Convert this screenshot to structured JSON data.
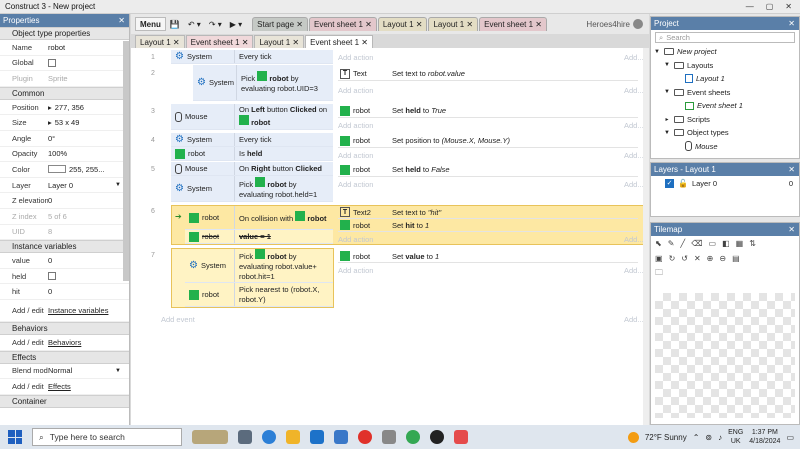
{
  "window": {
    "title": "Construct 3 - New project"
  },
  "left_panel": {
    "title": "Properties",
    "close": "✕",
    "sections": {
      "object_type": "Object type properties",
      "common": "Common",
      "instance_vars": "Instance variables",
      "behaviors": "Behaviors",
      "effects": "Effects",
      "container": "Container"
    },
    "name": {
      "k": "Name",
      "v": "robot"
    },
    "global": {
      "k": "Global"
    },
    "plugin": {
      "k": "Plugin",
      "v": "Sprite"
    },
    "position": {
      "k": "Position",
      "v": "277, 356"
    },
    "size": {
      "k": "Size",
      "v": "53 x 49"
    },
    "angle": {
      "k": "Angle",
      "v": "0°"
    },
    "opacity": {
      "k": "Opacity",
      "v": "100%"
    },
    "color": {
      "k": "Color",
      "v": "255, 255..."
    },
    "layer": {
      "k": "Layer",
      "v": "Layer 0"
    },
    "zelev": {
      "k": "Z elevation",
      "v": "0"
    },
    "zindex": {
      "k": "Z index",
      "v": "5 of 6"
    },
    "uid": {
      "k": "UID",
      "v": "8"
    },
    "var_value": {
      "k": "value",
      "v": "0"
    },
    "var_held": {
      "k": "held"
    },
    "var_hit": {
      "k": "hit",
      "v": "0"
    },
    "addedit_vars": {
      "k": "Add / edit",
      "v": "Instance variables"
    },
    "addedit_beh": {
      "k": "Add / edit",
      "v": "Behaviors"
    },
    "blend": {
      "k": "Blend mode",
      "v": "Normal"
    },
    "addedit_fx": {
      "k": "Add / edit",
      "v": "Effects"
    }
  },
  "toolbar": {
    "menu": "Menu",
    "save": "💾",
    "undo": "↶ ▾",
    "redo": "↷ ▾",
    "play": "▶ ▾",
    "user": "Heroes4hire",
    "tabs": [
      "Start page ✕",
      "Event sheet 1 ✕",
      "Layout 1 ✕",
      "Layout 1 ✕",
      "Event sheet 1 ✕"
    ]
  },
  "subtabs": [
    "Layout 1 ✕",
    "Event sheet 1 ✕",
    "Layout 1 ✕",
    "Event sheet 1 ✕"
  ],
  "sheet": {
    "add_action": "Add action",
    "add_dots": "Add...",
    "add_event": "Add event",
    "nums": [
      "1",
      "2",
      "3",
      "4",
      "5",
      "6",
      "7"
    ],
    "e1": {
      "obj": "System",
      "cond": "Every tick"
    },
    "e2": {
      "obj": "System",
      "cond_a": "Pick",
      "cond_obj": "robot",
      "cond_b": "by evaluating robot.UID=3",
      "a_obj": "Text",
      "a_pre": "Set text to",
      "a_val": "robot.value"
    },
    "e3": {
      "obj": "Mouse",
      "cond_a": "On",
      "btn": "Left",
      "cond_b": "button",
      "clk": "Clicked",
      "cond_c": "on",
      "cond_obj": "robot",
      "a_obj": "robot",
      "a_pre": "Set",
      "a_var": "held",
      "a_mid": "to",
      "a_val": "True"
    },
    "e4": {
      "obj1": "System",
      "cond1": "Every tick",
      "obj2": "robot",
      "cond2_a": "Is",
      "cond2_b": "held",
      "a_obj": "robot",
      "a_pre": "Set position to",
      "a_val": "(Mouse.X, Mouse.Y)"
    },
    "e5": {
      "obj1": "Mouse",
      "cond1_a": "On",
      "btn": "Right",
      "cond1_b": "button",
      "clk": "Clicked",
      "obj2": "System",
      "cond2_a": "Pick",
      "cond2_obj": "robot",
      "cond2_b": "by evaluating robot.held=1",
      "a_obj": "robot",
      "a_pre": "Set",
      "a_var": "held",
      "a_mid": "to",
      "a_val": "False"
    },
    "e6": {
      "obj1": "robot",
      "cond1_a": "On collision with",
      "cond1_obj": "robot",
      "obj2": "robot",
      "cond2": "value = 1",
      "a1_obj": "Text2",
      "a1_pre": "Set text to",
      "a1_val": "\"hit\"",
      "a2_obj": "robot",
      "a2_pre": "Set",
      "a2_var": "hit",
      "a2_mid": "to",
      "a2_val": "1"
    },
    "e7": {
      "obj1": "System",
      "cond1_a": "Pick",
      "cond1_obj": "robot",
      "cond1_b": "by evaluating robot.value+ robot.hit=1",
      "obj2": "robot",
      "cond2": "Pick nearest to (robot.X, robot.Y)",
      "a_obj": "robot",
      "a_pre": "Set",
      "a_var": "value",
      "a_mid": "to",
      "a_val": "1"
    }
  },
  "project_panel": {
    "title": "Project",
    "search": "Search",
    "items": [
      "New project",
      "Layouts",
      "Layout 1",
      "Event sheets",
      "Event sheet 1",
      "Scripts",
      "Object types",
      "Mouse"
    ]
  },
  "layers_panel": {
    "title": "Layers - Layout 1",
    "layer": "Layer 0",
    "count": "0"
  },
  "tilemap_panel": {
    "title": "Tilemap"
  },
  "taskbar": {
    "search": "Type here to search",
    "weather": "72°F  Sunny",
    "lang1": "ENG",
    "lang2": "UK",
    "time": "1:37 PM",
    "date": "4/18/2024"
  }
}
